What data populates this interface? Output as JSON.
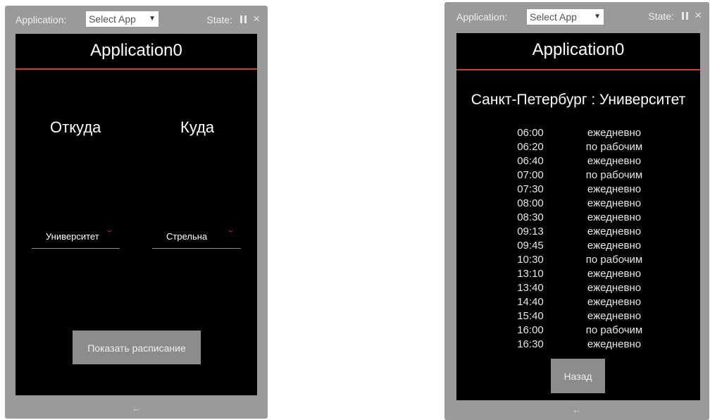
{
  "left_window": {
    "toolbar": {
      "application_label": "Application:",
      "select_value": "Select App",
      "state_label": "State:"
    },
    "screen": {
      "title": "Application0",
      "from_label": "Откуда",
      "to_label": "Куда",
      "from_value": "Университет",
      "to_value": "Стрельна",
      "show_button": "Показать расписание"
    },
    "nav_back": "←"
  },
  "right_window": {
    "toolbar": {
      "application_label": "Application:",
      "select_value": "Select App",
      "state_label": "State:"
    },
    "screen": {
      "title": "Application0",
      "route": "Санкт-Петербург : Университет",
      "schedule": [
        {
          "time": "06:00",
          "days": "ежедневно"
        },
        {
          "time": "06:20",
          "days": "по рабочим"
        },
        {
          "time": "06:40",
          "days": "ежедневно"
        },
        {
          "time": "07:00",
          "days": "по рабочим"
        },
        {
          "time": "07:30",
          "days": "ежедневно"
        },
        {
          "time": "08:00",
          "days": "ежедневно"
        },
        {
          "time": "08:30",
          "days": "ежедневно"
        },
        {
          "time": "09:13",
          "days": "ежедневно"
        },
        {
          "time": "09:45",
          "days": "ежедневно"
        },
        {
          "time": "10:30",
          "days": "по рабочим"
        },
        {
          "time": "13:10",
          "days": "ежедневно"
        },
        {
          "time": "13:40",
          "days": "ежедневно"
        },
        {
          "time": "14:40",
          "days": "ежедневно"
        },
        {
          "time": "15:40",
          "days": "ежедневно"
        },
        {
          "time": "16:00",
          "days": "по рабочим"
        },
        {
          "time": "16:30",
          "days": "ежедневно"
        }
      ],
      "back_button": "Назад"
    },
    "nav_back": "←"
  },
  "colors": {
    "accent_line": "#c8422a",
    "dropdown_chevron": "#e0102a",
    "emulator_frame": "#9a9a9a"
  }
}
